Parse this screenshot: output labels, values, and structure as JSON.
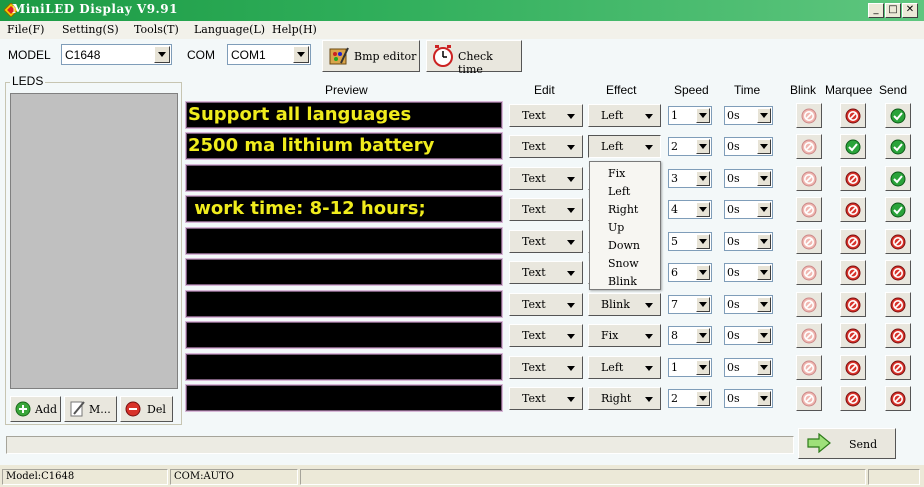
{
  "window": {
    "title": "MiniLED Display V9.91",
    "minimize": "_",
    "maximize": "□",
    "close": "✕"
  },
  "menu": [
    "File(F)",
    "Setting(S)",
    "Tools(T)",
    "Language(L)",
    "Help(H)"
  ],
  "toolbar": {
    "model_label": "MODEL",
    "model_value": "C1648",
    "com_label": "COM",
    "com_value": "COM1",
    "bmp_editor": "Bmp editor",
    "check_time": "Check time"
  },
  "leds": {
    "title": "LEDS",
    "add": "Add",
    "modify": "M...",
    "delete": "Del"
  },
  "columns": {
    "preview": "Preview",
    "edit": "Edit",
    "effect": "Effect",
    "speed": "Speed",
    "time": "Time",
    "blink": "Blink",
    "marquee": "Marquee",
    "send": "Send"
  },
  "rows": [
    {
      "text": "Support all languages",
      "edit": "Text",
      "effect": "Left",
      "speed": "1",
      "time": "0s",
      "blink": "off",
      "marquee": "off",
      "send": "on"
    },
    {
      "text": "2500 ma lithium battery",
      "edit": "Text",
      "effect": "Left",
      "speed": "2",
      "time": "0s",
      "blink": "off",
      "marquee": "on",
      "send": "on"
    },
    {
      "text": "",
      "edit": "Text",
      "effect": "",
      "speed": "3",
      "time": "0s",
      "blink": "off",
      "marquee": "off",
      "send": "on"
    },
    {
      "text": " work time: 8-12 hours;",
      "edit": "Text",
      "effect": "",
      "speed": "4",
      "time": "0s",
      "blink": "off",
      "marquee": "off",
      "send": "on"
    },
    {
      "text": "",
      "edit": "Text",
      "effect": "",
      "speed": "5",
      "time": "0s",
      "blink": "off",
      "marquee": "off",
      "send": "off"
    },
    {
      "text": "",
      "edit": "Text",
      "effect": "",
      "speed": "6",
      "time": "0s",
      "blink": "off",
      "marquee": "off",
      "send": "off"
    },
    {
      "text": "",
      "edit": "Text",
      "effect": "Blink",
      "speed": "7",
      "time": "0s",
      "blink": "off",
      "marquee": "off",
      "send": "off"
    },
    {
      "text": "",
      "edit": "Text",
      "effect": "Fix",
      "speed": "8",
      "time": "0s",
      "blink": "off",
      "marquee": "off",
      "send": "off"
    },
    {
      "text": "",
      "edit": "Text",
      "effect": "Left",
      "speed": "1",
      "time": "0s",
      "blink": "off",
      "marquee": "off",
      "send": "off"
    },
    {
      "text": "",
      "edit": "Text",
      "effect": "Right",
      "speed": "2",
      "time": "0s",
      "blink": "off",
      "marquee": "off",
      "send": "off"
    }
  ],
  "effect_options": [
    "Fix",
    "Left",
    "Right",
    "Up",
    "Down",
    "Snow",
    "Blink"
  ],
  "send_button": "Send",
  "status": {
    "model": "Model:C1648",
    "com": "COM:AUTO"
  },
  "colors": {
    "title_bar": "#2fae5a",
    "preview_text": "#f0ec1d",
    "preview_bg": "#000000",
    "check_green": "#2aa33a",
    "stop_red": "#d8322a"
  }
}
